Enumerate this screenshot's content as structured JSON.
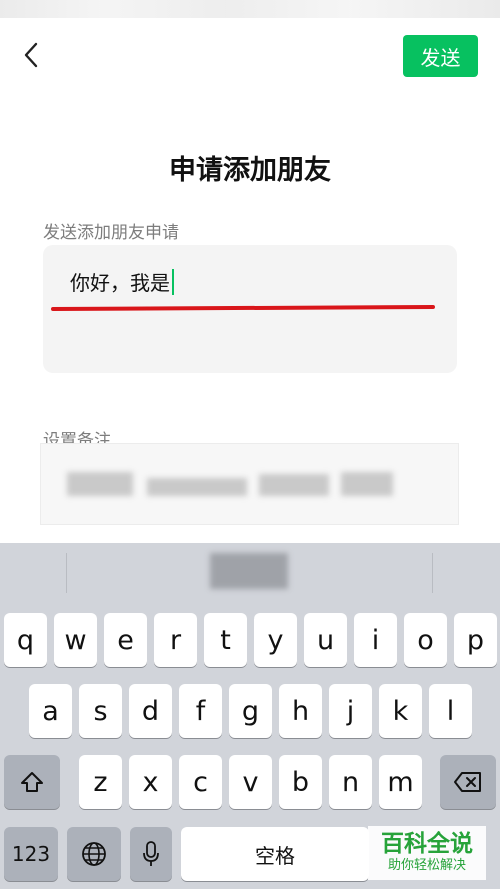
{
  "header": {
    "send_label": "发送",
    "back_icon": "chevron-left-icon"
  },
  "page": {
    "title": "申请添加朋友",
    "request_label": "发送添加朋友申请",
    "request_text": "你好，我是",
    "remark_label": "设置备注"
  },
  "colors": {
    "accent": "#07c160",
    "annotation": "#d9161a",
    "watermark": "#27a33a"
  },
  "keyboard": {
    "row1": [
      "q",
      "w",
      "e",
      "r",
      "t",
      "y",
      "u",
      "i",
      "o",
      "p"
    ],
    "row2": [
      "a",
      "s",
      "d",
      "f",
      "g",
      "h",
      "j",
      "k",
      "l"
    ],
    "row3": [
      "z",
      "x",
      "c",
      "v",
      "b",
      "n",
      "m"
    ],
    "shift_icon": "shift-icon",
    "delete_icon": "backspace-icon",
    "numbers_label": "123",
    "globe_icon": "globe-icon",
    "mic_icon": "microphone-icon",
    "space_label": "空格"
  },
  "watermark": {
    "title": "百科全说",
    "subtitle": "助你轻松解决"
  }
}
